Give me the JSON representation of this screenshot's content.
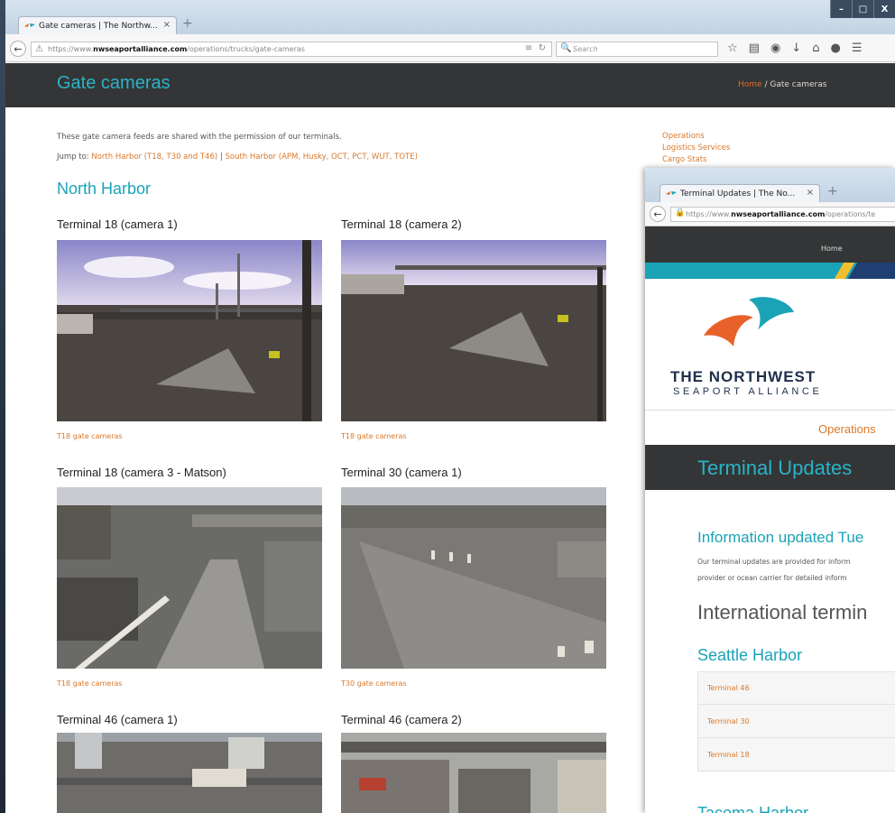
{
  "browser1": {
    "tab_title": "Gate cameras | The Northw...",
    "tab_close": "×",
    "new_tab": "+",
    "url_prefix": "https://www.",
    "url_domain": "nwseaportalliance.com",
    "url_path": "/operations/trucks/gate-cameras",
    "search_placeholder": "Search",
    "window_controls": [
      "–",
      "□",
      "X"
    ]
  },
  "site": {
    "page_title": "Gate cameras",
    "breadcrumb_home": "Home",
    "breadcrumb_separator": "/",
    "breadcrumb_current": "Gate cameras",
    "intro_text": "These gate camera feeds are shared with the permission of our terminals.",
    "jump_label": "Jump to:",
    "jump_north": "North Harbor (T18, T30 and T46)",
    "jump_divider": "|",
    "jump_south": "South Harbor (APM, Husky, OCT, PCT, WUT, TOTE)",
    "sidenav": [
      "Operations",
      "Logistics Services",
      "Cargo Stats"
    ],
    "section_heading": "North Harbor",
    "cameras": [
      {
        "title": "Terminal 18 (camera 1)",
        "link": "T18 gate cameras"
      },
      {
        "title": "Terminal 18 (camera 2)",
        "link": "T18 gate cameras"
      },
      {
        "title": "Terminal 18 (camera 3 - Matson)",
        "link": "T18 gate cameras"
      },
      {
        "title": "Terminal 30 (camera 1)",
        "link": "T30 gate cameras"
      },
      {
        "title": "Terminal 46 (camera 1)",
        "link": ""
      },
      {
        "title": "Terminal 46 (camera 2)",
        "link": ""
      }
    ]
  },
  "browser2": {
    "tab_title": "Terminal Updates | The No...",
    "tab_close": "×",
    "new_tab": "+",
    "url_prefix": "https://www.",
    "url_domain": "nwseaportalliance.com",
    "url_path": "/operations/te",
    "nav_home": "Home",
    "logo_line1": "THE NORTHWEST",
    "logo_line2": "SEAPORT ALLIANCE",
    "operations_link": "Operations",
    "banner_title": "Terminal Updates",
    "info_heading": "Information updated Tue",
    "body_line1": "Our terminal updates are provided for inform",
    "body_line2": "provider or ocean carrier for detailed inform",
    "intl_heading": "International termin",
    "seattle_heading": "Seattle Harbor",
    "seattle_terminals": [
      "Terminal 46",
      "Terminal 30",
      "Terminal 18"
    ],
    "tacoma_heading": "Tacoma Harbor"
  },
  "colors": {
    "teal": "#1aa3b7",
    "orange_link": "#d9782a",
    "header_dark": "#343536",
    "navy": "#1f2f4a"
  }
}
